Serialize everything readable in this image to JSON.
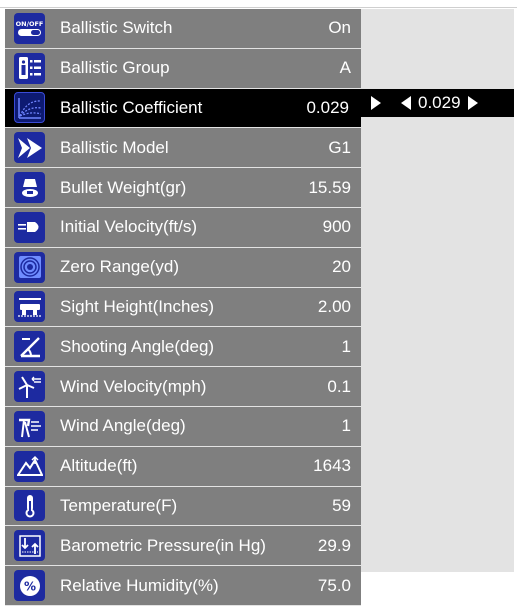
{
  "menu": {
    "items": [
      {
        "label": "Ballistic Switch",
        "value": "On",
        "icon": "on-off-switch-icon",
        "selected": false
      },
      {
        "label": "Ballistic Group",
        "value": "A",
        "icon": "group-list-icon",
        "selected": false
      },
      {
        "label": "Ballistic Coefficient",
        "value": "0.029",
        "icon": "trajectory-coefficient-icon",
        "selected": true
      },
      {
        "label": "Ballistic Model",
        "value": "G1",
        "icon": "bullet-model-icon",
        "selected": false
      },
      {
        "label": "Bullet Weight(gr)",
        "value": "15.59",
        "icon": "bullet-weight-icon",
        "selected": false
      },
      {
        "label": "Initial Velocity(ft/s)",
        "value": "900",
        "icon": "velocity-bullet-icon",
        "selected": false
      },
      {
        "label": "Zero Range(yd)",
        "value": "20",
        "icon": "target-icon",
        "selected": false
      },
      {
        "label": "Sight Height(Inches)",
        "value": "2.00",
        "icon": "sight-height-icon",
        "selected": false
      },
      {
        "label": "Shooting Angle(deg)",
        "value": "1",
        "icon": "angle-icon",
        "selected": false
      },
      {
        "label": "Wind Velocity(mph)",
        "value": "0.1",
        "icon": "wind-turbine-icon",
        "selected": false
      },
      {
        "label": "Wind Angle(deg)",
        "value": "1",
        "icon": "wind-angle-icon",
        "selected": false
      },
      {
        "label": "Altitude(ft)",
        "value": "1643",
        "icon": "mountain-icon",
        "selected": false
      },
      {
        "label": "Temperature(F)",
        "value": "59",
        "icon": "thermometer-icon",
        "selected": false
      },
      {
        "label": "Barometric Pressure(in Hg)",
        "value": "29.9",
        "icon": "barometer-icon",
        "selected": false
      },
      {
        "label": "Relative Humidity(%)",
        "value": "75.0",
        "icon": "humidity-percent-icon",
        "selected": false
      }
    ]
  },
  "editor": {
    "value": "0.029",
    "arrow_right_icon": "triangle-right-icon",
    "arrow_left_icon": "triangle-left-icon"
  },
  "colors": {
    "row_bg": "#7f7f7f",
    "row_selected_bg": "#000000",
    "icon_bg": "#1d2aa0",
    "panel_bg": "#e3e3e3",
    "text": "#ffffff"
  }
}
